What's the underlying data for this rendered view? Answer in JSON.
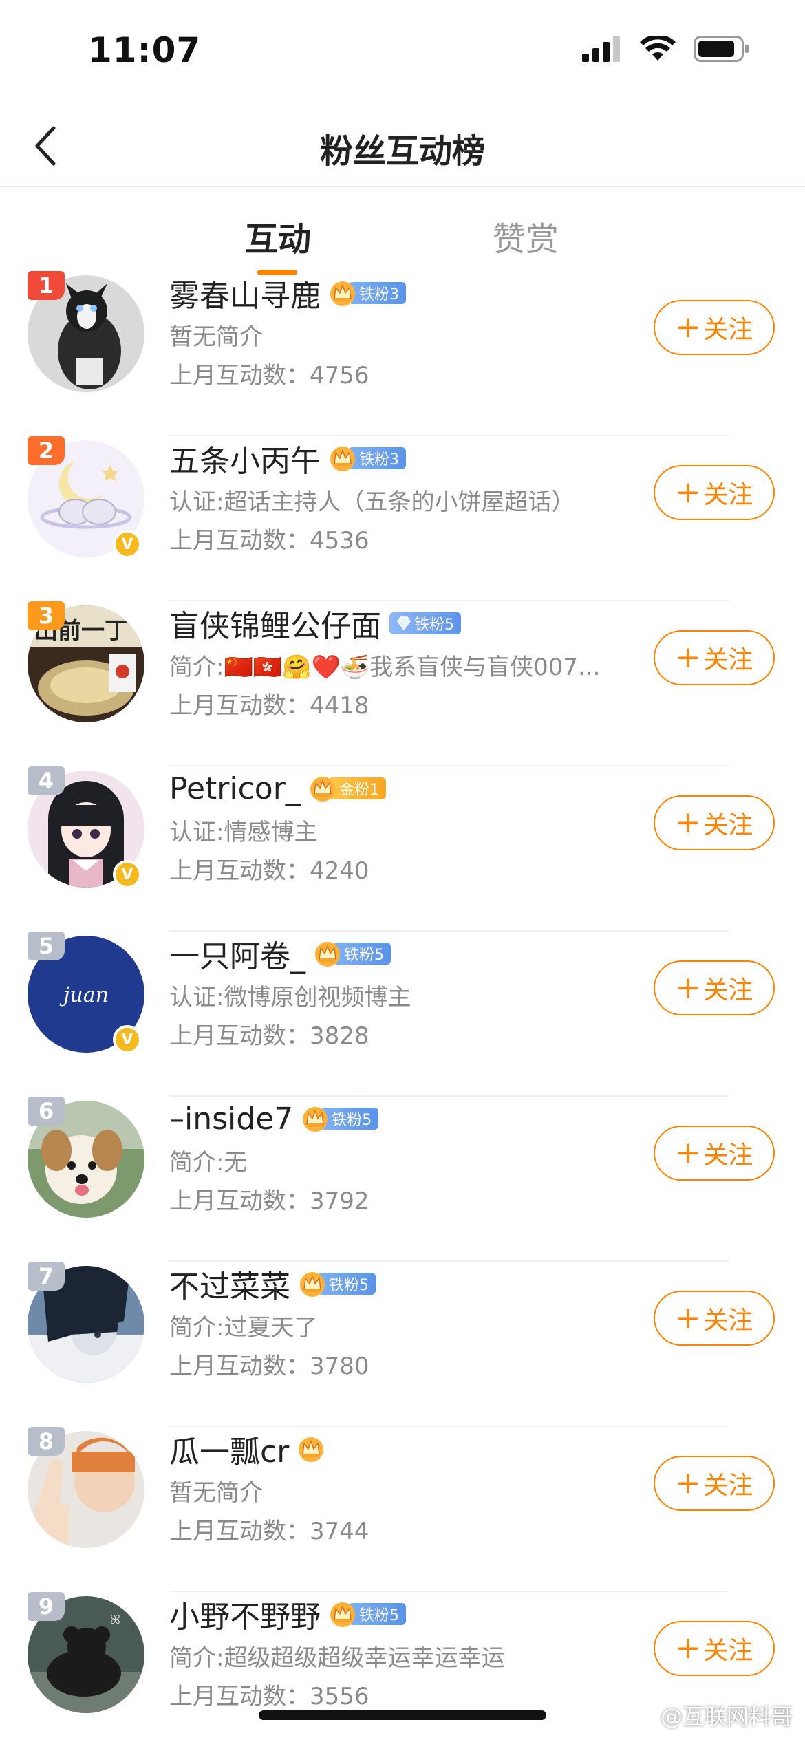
{
  "status_bar": {
    "time": "11:07"
  },
  "nav": {
    "title": "粉丝互动榜"
  },
  "tabs": [
    {
      "label": "互动",
      "active": true
    },
    {
      "label": "赞赏",
      "active": false
    }
  ],
  "follow_label": "关注",
  "colors": {
    "accent": "#ff8200",
    "rank1": "#f04b3a",
    "rank2": "#ff6d2d",
    "rank3": "#ff9a1f",
    "rankN": "#b8bdca",
    "iron_badge": "#6ea3ee",
    "gold_badge": "#f5a623"
  },
  "users": [
    {
      "rank": "1",
      "name": "雾春山寻鹿",
      "badge": "铁粉3",
      "badge_type": "iron",
      "desc": "暂无简介",
      "count": "上月互动数：4756",
      "verified": false
    },
    {
      "rank": "2",
      "name": "五条小丙午",
      "badge": "铁粉3",
      "badge_type": "iron",
      "desc": "认证:超话主持人（五条的小饼屋超话）",
      "count": "上月互动数：4536",
      "verified": true
    },
    {
      "rank": "3",
      "name": "盲侠锦鲤公仔面",
      "badge": "铁粉5",
      "badge_type": "diamond",
      "desc": "简介:🇨🇳🇭🇰🤗❤️🍜我系盲侠与盲侠007...",
      "count": "上月互动数：4418",
      "verified": false
    },
    {
      "rank": "4",
      "name": "Petricor_",
      "badge": "金粉1",
      "badge_type": "gold",
      "desc": "认证:情感博主",
      "count": "上月互动数：4240",
      "verified": true
    },
    {
      "rank": "5",
      "name": "一只阿卷_",
      "badge": "铁粉5",
      "badge_type": "iron",
      "desc": "认证:微博原创视频博主",
      "count": "上月互动数：3828",
      "verified": true
    },
    {
      "rank": "6",
      "name": "–inside7",
      "badge": "铁粉5",
      "badge_type": "iron",
      "desc": "简介:无",
      "count": "上月互动数：3792",
      "verified": false
    },
    {
      "rank": "7",
      "name": "不过菜菜",
      "badge": "铁粉5",
      "badge_type": "iron",
      "desc": "简介:过夏天了",
      "count": "上月互动数：3780",
      "verified": false
    },
    {
      "rank": "8",
      "name": "瓜一瓢cr",
      "badge": "",
      "badge_type": "crown",
      "desc": "暂无简介",
      "count": "上月互动数：3744",
      "verified": false
    },
    {
      "rank": "9",
      "name": "小野不野野",
      "badge": "铁粉5",
      "badge_type": "iron",
      "desc": "简介:超级超级超级幸运幸运幸运",
      "count": "上月互动数：3556",
      "verified": false
    }
  ],
  "watermark": "@互联网料哥",
  "icons": {
    "back": "chevron-left-icon",
    "signal": "cellular-signal-icon",
    "wifi": "wifi-icon",
    "battery": "battery-icon",
    "crown": "crown-icon",
    "verified": "verified-v-icon",
    "weibo": "weibo-logo-icon"
  }
}
